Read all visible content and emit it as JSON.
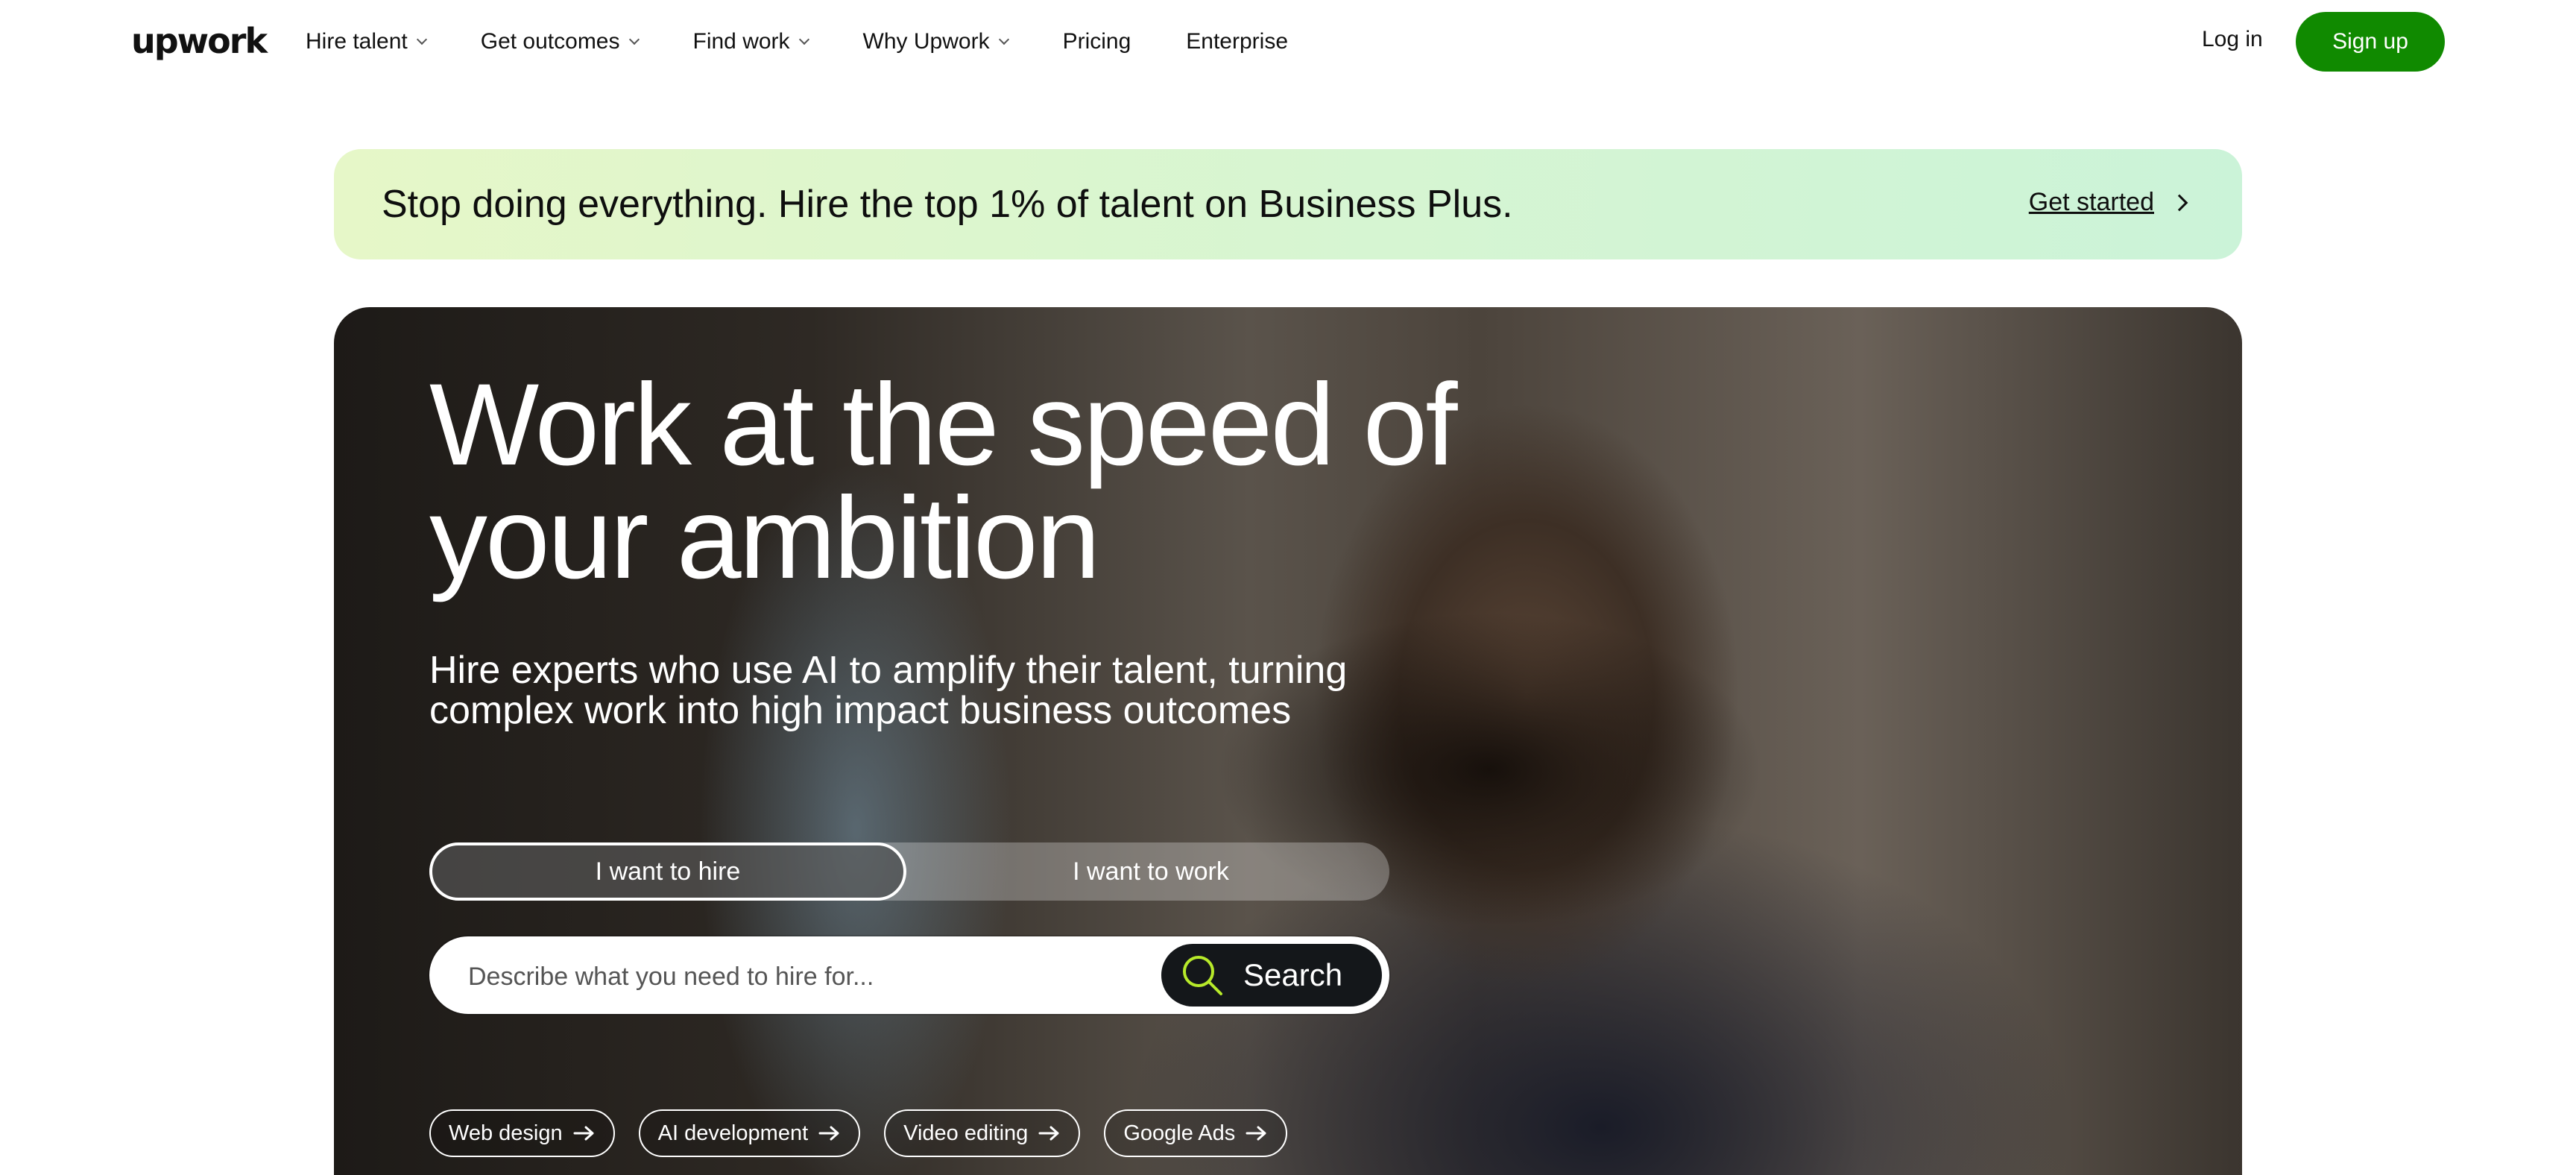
{
  "nav": {
    "logo": "upwork",
    "items": [
      {
        "label": "Hire talent",
        "dropdown": true
      },
      {
        "label": "Get outcomes",
        "dropdown": true
      },
      {
        "label": "Find work",
        "dropdown": true
      },
      {
        "label": "Why Upwork",
        "dropdown": true
      },
      {
        "label": "Pricing",
        "dropdown": false
      },
      {
        "label": "Enterprise",
        "dropdown": false
      }
    ],
    "login": "Log in",
    "signup": "Sign up"
  },
  "promo": {
    "text": "Stop doing everything. Hire the top 1% of talent on Business Plus.",
    "cta": "Get started"
  },
  "hero": {
    "headline_line1": "Work at the speed of",
    "headline_line2": "your ambition",
    "subhead_line1": "Hire experts who use AI to amplify their talent, turning",
    "subhead_line2": "complex work into high impact business outcomes",
    "toggle": {
      "hire": "I want to hire",
      "work": "I want to work",
      "selected": "hire"
    },
    "search": {
      "placeholder": "Describe what you need to hire for...",
      "button": "Search"
    },
    "chips": [
      "Web design",
      "AI development",
      "Video editing",
      "Google Ads"
    ]
  },
  "colors": {
    "brand_green": "#108a00",
    "search_icon_accent": "#b7ea2a",
    "search_button_bg": "#14171a"
  },
  "icons": {
    "nav_dropdown": "chevron-down-icon",
    "promo_cta": "chevron-right-icon",
    "search": "search-icon",
    "chip": "arrow-right-icon"
  }
}
